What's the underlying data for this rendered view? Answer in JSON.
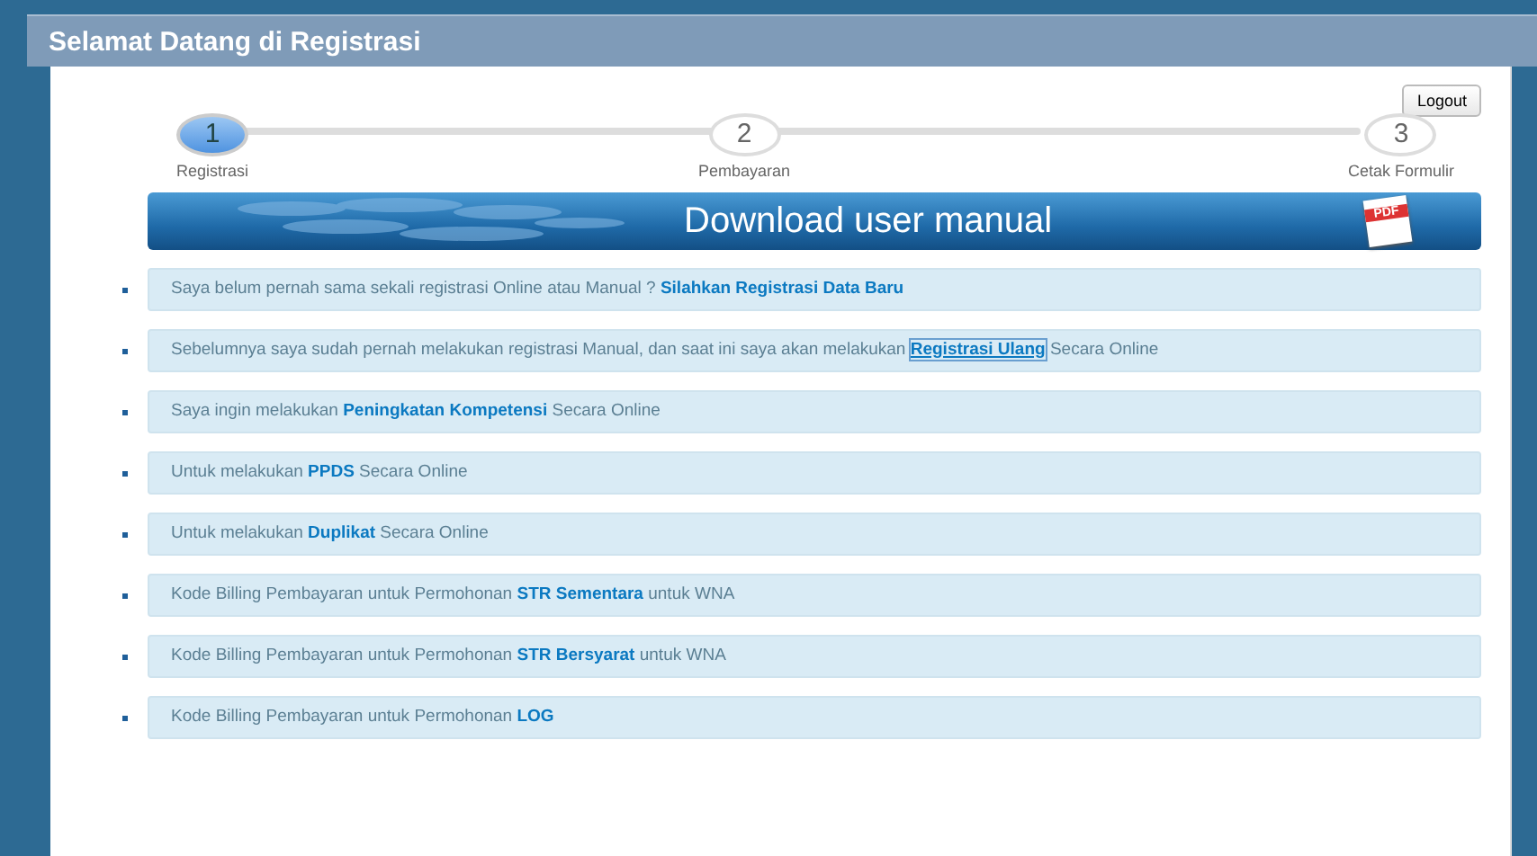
{
  "header": {
    "title": "Selamat Datang di Registrasi"
  },
  "logout": "Logout",
  "steps": [
    {
      "number": "1",
      "label": "Registrasi",
      "selected": true
    },
    {
      "number": "2",
      "label": "Pembayaran",
      "selected": false
    },
    {
      "number": "3",
      "label": "Cetak Formulir",
      "selected": false
    }
  ],
  "banner": {
    "text": "Download user manual",
    "icon_text": "PDF"
  },
  "items": [
    {
      "before": "Saya belum pernah sama sekali registrasi Online atau Manual ? ",
      "link": "Silahkan Registrasi Data Baru",
      "focused": false
    },
    {
      "before": "Sebelumnya saya sudah pernah melakukan registrasi Manual, dan saat ini saya akan melakukan ",
      "link": "Registrasi Ulang",
      "after": " Secara Online",
      "focused": true
    },
    {
      "before": "Saya ingin melakukan ",
      "link": "Peningkatan Kompetensi",
      "after": " Secara Online",
      "focused": false
    },
    {
      "before": "Untuk melakukan ",
      "link": "PPDS",
      "after": " Secara Online",
      "focused": false
    },
    {
      "before": "Untuk melakukan ",
      "link": "Duplikat",
      "after": " Secara Online",
      "focused": false
    },
    {
      "before": "Kode Billing Pembayaran untuk Permohonan ",
      "link": "STR Sementara",
      "after": " untuk WNA",
      "focused": false
    },
    {
      "before": "Kode Billing Pembayaran untuk Permohonan ",
      "link": "STR Bersyarat",
      "after": " untuk WNA",
      "focused": false
    },
    {
      "before": "Kode Billing Pembayaran untuk Permohonan ",
      "link": "LOG",
      "focused": false
    }
  ]
}
